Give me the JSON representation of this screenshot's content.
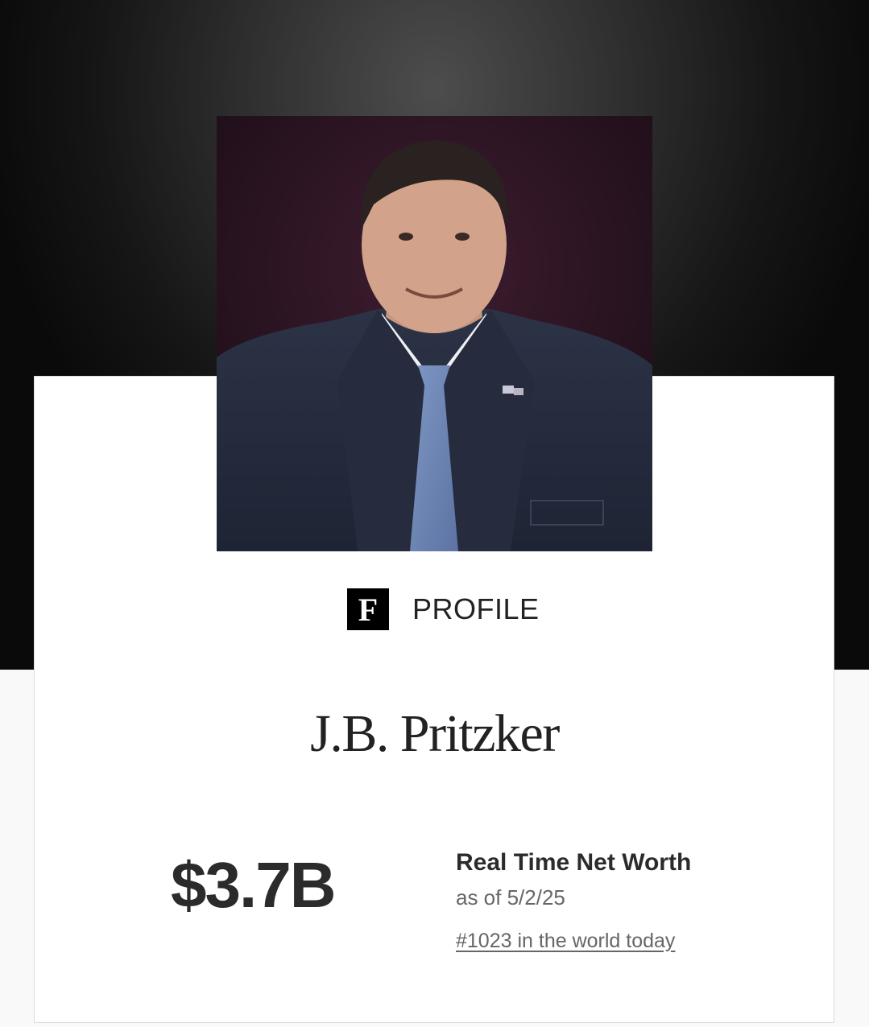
{
  "profile": {
    "logo_letter": "F",
    "section_label": "PROFILE",
    "name": "J.B. Pritzker",
    "photo_icon": "portrait-photo"
  },
  "net_worth": {
    "value": "$3.7B",
    "label": "Real Time Net Worth",
    "as_of": "as of 5/2/25",
    "rank_link": "#1023 in the world today"
  },
  "colors": {
    "hero_background": "#1a1a1a",
    "card_background": "#ffffff",
    "text_primary": "#2b2b2b",
    "text_secondary": "#666666"
  }
}
